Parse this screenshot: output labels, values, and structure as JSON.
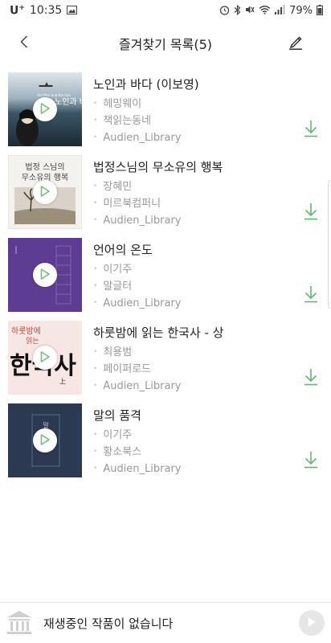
{
  "status_bar": {
    "carrier": "U",
    "carrier_sup": "+",
    "time": "10:35",
    "battery": "79%",
    "icons": [
      "image-icon",
      "alarm-icon",
      "bluetooth-icon",
      "mute-icon",
      "wifi-icon",
      "signal-icon",
      "battery-icon"
    ]
  },
  "header": {
    "title": "즐겨찾기 목록(5)",
    "back_icon": "chevron-left-icon",
    "edit_icon": "pencil-icon"
  },
  "colors": {
    "accent": "#5fb86e",
    "play_triangle": "#6dc07b"
  },
  "books": [
    {
      "title": "노인과 바다 (이보영)",
      "author": "헤밍웨이",
      "publisher": "책읽는동네",
      "library": "Audien_Library"
    },
    {
      "title": "법정스님의 무소유의 행복",
      "author": "장혜민",
      "publisher": "미르북컴퍼니",
      "library": "Audien_Library"
    },
    {
      "title": "언어의 온도",
      "author": "이기주",
      "publisher": "말글터",
      "library": "Audien_Library"
    },
    {
      "title": "하룻밤에 읽는 한국사 - 상",
      "author": "최용범",
      "publisher": "페이퍼로드",
      "library": "Audien_Library"
    },
    {
      "title": "말의 품격",
      "author": "이기주",
      "publisher": "황소북스",
      "library": "Audien_Library"
    }
  ],
  "covers": {
    "book1": {
      "line1": "노인과 바다",
      "small": "Old Man and the Sea"
    },
    "book2": {
      "line1": "법정 스님의",
      "line2": "무소유의 행복"
    },
    "book4": {
      "line1": "하룻밤에",
      "line2": "읽는",
      "big": "한국사",
      "sub": "上"
    },
    "book5": {
      "line1": "말"
    }
  },
  "player": {
    "message": "재생중인 작품이 없습니다",
    "logo_icon": "library-logo-icon",
    "play_icon": "play-icon"
  }
}
